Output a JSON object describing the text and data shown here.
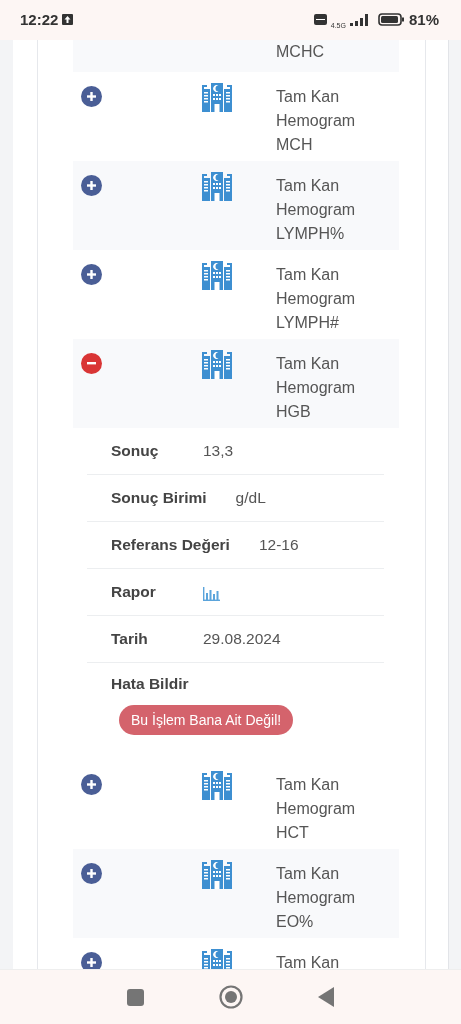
{
  "status_bar": {
    "time": "12:22",
    "network": "4.5G",
    "battery": "81%"
  },
  "records": [
    {
      "kind": "cut",
      "lines": [
        "MCHC"
      ]
    },
    {
      "kind": "record",
      "expanded": false,
      "lines": [
        "Tam Kan",
        "Hemogram",
        "MCH"
      ]
    },
    {
      "kind": "record",
      "expanded": false,
      "lines": [
        "Tam Kan",
        "Hemogram",
        "LYMPH%"
      ]
    },
    {
      "kind": "record",
      "expanded": false,
      "lines": [
        "Tam Kan",
        "Hemogram",
        "LYMPH#"
      ]
    },
    {
      "kind": "record",
      "expanded": true,
      "lines": [
        "Tam Kan",
        "Hemogram",
        "HGB"
      ],
      "details": [
        {
          "kind": "text",
          "label": "Sonuç",
          "value": "13,3"
        },
        {
          "kind": "text",
          "label": "Sonuç Birimi",
          "value": "g/dL"
        },
        {
          "kind": "text",
          "label": "Referans Değeri",
          "value": "12-16"
        },
        {
          "kind": "report",
          "label": "Rapor"
        },
        {
          "kind": "text",
          "label": "Tarih",
          "value": "29.08.2024"
        },
        {
          "kind": "action",
          "label": "Hata Bildir",
          "button": "Bu İşlem Bana Ait Değil!"
        }
      ]
    },
    {
      "kind": "record",
      "expanded": false,
      "lines": [
        "Tam Kan",
        "Hemogram",
        "HCT"
      ]
    },
    {
      "kind": "record",
      "expanded": false,
      "lines": [
        "Tam Kan",
        "Hemogram",
        "EO%"
      ]
    },
    {
      "kind": "record",
      "expanded": false,
      "lines": [
        "Tam Kan"
      ]
    }
  ]
}
